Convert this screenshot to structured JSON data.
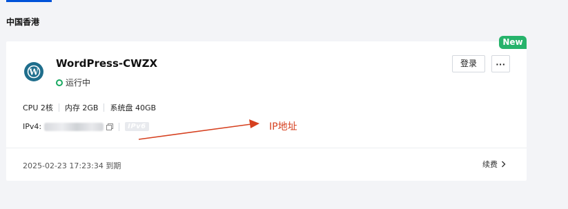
{
  "region": {
    "title": "中国香港"
  },
  "card": {
    "badge": "New",
    "name": "WordPress-CWZX",
    "status": "运行中",
    "actions": {
      "login": "登录",
      "more": "···"
    },
    "specs": [
      "CPU 2核",
      "内存 2GB",
      "系统盘 40GB"
    ],
    "ipv4_label": "IPv4:",
    "ipv6_badge": "IPv6",
    "expiry": "2025-02-23 17:23:34 到期",
    "renew": "续费"
  },
  "annotation": {
    "label": "IP地址"
  },
  "icons": {
    "logo": "wordpress-icon",
    "status": "status-dot-icon",
    "copy": "copy-icon",
    "renew": "chevron-right-icon"
  },
  "colors": {
    "accent": "#0052d9",
    "badge": "#26b36b",
    "status": "#18a860",
    "annotation": "#d6401f"
  }
}
